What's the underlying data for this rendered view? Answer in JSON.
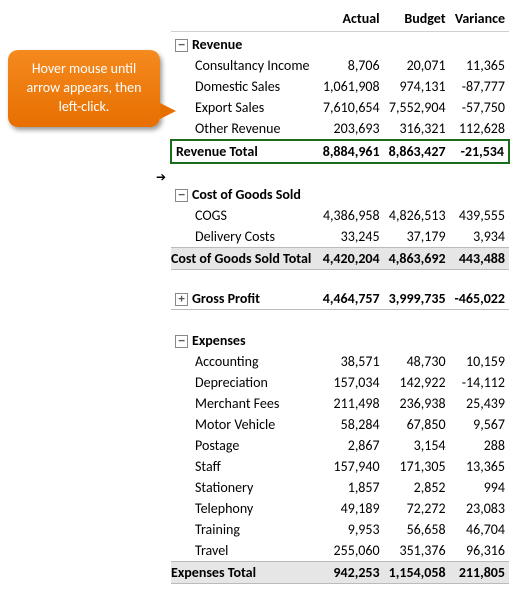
{
  "callout_text": "Hover mouse until arrow appears, then left-click.",
  "headers": {
    "c1": "Actual",
    "c2": "Budget",
    "c3": "Variance"
  },
  "icons": {
    "minus": "−",
    "plus": "+"
  },
  "revenue": {
    "title": "Revenue",
    "items": [
      {
        "label": "Consultancy Income",
        "actual": "8,706",
        "budget": "20,071",
        "variance": "11,365"
      },
      {
        "label": "Domestic Sales",
        "actual": "1,061,908",
        "budget": "974,131",
        "variance": "-87,777"
      },
      {
        "label": "Export Sales",
        "actual": "7,610,654",
        "budget": "7,552,904",
        "variance": "-57,750"
      },
      {
        "label": "Other Revenue",
        "actual": "203,693",
        "budget": "316,321",
        "variance": "112,628"
      }
    ],
    "total_label": "Revenue Total",
    "total": {
      "actual": "8,884,961",
      "budget": "8,863,427",
      "variance": "-21,534"
    }
  },
  "cogs": {
    "title": "Cost of Goods Sold",
    "items": [
      {
        "label": "COGS",
        "actual": "4,386,958",
        "budget": "4,826,513",
        "variance": "439,555"
      },
      {
        "label": "Delivery Costs",
        "actual": "33,245",
        "budget": "37,179",
        "variance": "3,934"
      }
    ],
    "total_label": "Cost of Goods Sold Total",
    "total": {
      "actual": "4,420,204",
      "budget": "4,863,692",
      "variance": "443,488"
    }
  },
  "gross_profit": {
    "title": "Gross Profit",
    "actual": "4,464,757",
    "budget": "3,999,735",
    "variance": "-465,022"
  },
  "expenses": {
    "title": "Expenses",
    "items": [
      {
        "label": "Accounting",
        "actual": "38,571",
        "budget": "48,730",
        "variance": "10,159"
      },
      {
        "label": "Depreciation",
        "actual": "157,034",
        "budget": "142,922",
        "variance": "-14,112"
      },
      {
        "label": "Merchant Fees",
        "actual": "211,498",
        "budget": "236,938",
        "variance": "25,439"
      },
      {
        "label": "Motor Vehicle",
        "actual": "58,284",
        "budget": "67,850",
        "variance": "9,567"
      },
      {
        "label": "Postage",
        "actual": "2,867",
        "budget": "3,154",
        "variance": "288"
      },
      {
        "label": "Staff",
        "actual": "157,940",
        "budget": "171,305",
        "variance": "13,365"
      },
      {
        "label": "Stationery",
        "actual": "1,857",
        "budget": "2,852",
        "variance": "994"
      },
      {
        "label": "Telephony",
        "actual": "49,189",
        "budget": "72,272",
        "variance": "23,083"
      },
      {
        "label": "Training",
        "actual": "9,953",
        "budget": "56,658",
        "variance": "46,704"
      },
      {
        "label": "Travel",
        "actual": "255,060",
        "budget": "351,376",
        "variance": "96,316"
      }
    ],
    "total_label": "Expenses Total",
    "total": {
      "actual": "942,253",
      "budget": "1,154,058",
      "variance": "211,805"
    }
  }
}
